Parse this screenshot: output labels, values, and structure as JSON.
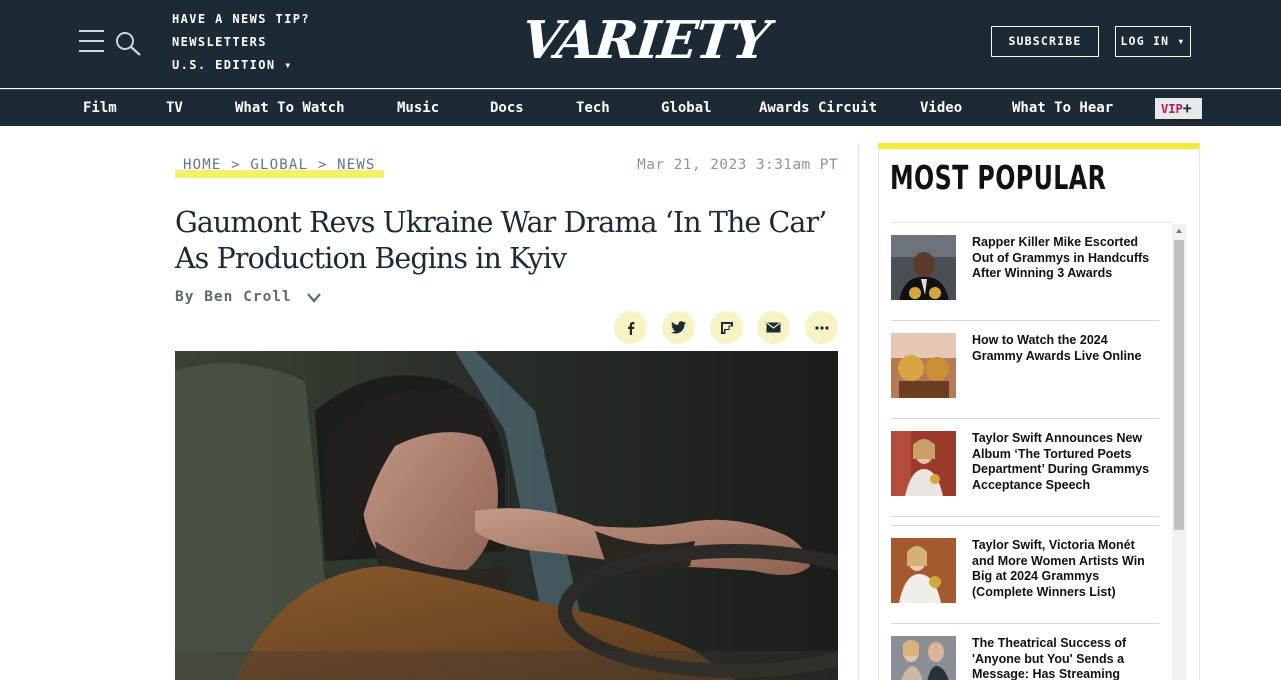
{
  "header": {
    "tips": [
      "HAVE A NEWS TIP?",
      "NEWSLETTERS",
      "U.S. EDITION ▾"
    ],
    "logo": "VARIETY",
    "subscribe_label": "SUBSCRIBE",
    "login_label": "LOG IN ▾"
  },
  "nav": {
    "items": [
      "Film",
      "TV",
      "What To Watch",
      "Music",
      "Docs",
      "Tech",
      "Global",
      "Awards Circuit",
      "Video",
      "What To Hear"
    ],
    "vip_label": "VIP",
    "vip_plus": "+"
  },
  "article": {
    "breadcrumb": [
      "HOME",
      "GLOBAL",
      "NEWS"
    ],
    "breadcrumb_sep": ">",
    "date": "Mar 21, 2023 3:31am PT",
    "headline": "Gaumont Revs Ukraine War Drama ‘In The Car’ As Production Begins in Kyiv",
    "byline": "By Ben Croll",
    "share_icons": [
      "facebook-icon",
      "twitter-icon",
      "flipboard-icon",
      "email-icon",
      "more-icon"
    ]
  },
  "sidebar": {
    "title": "MOST POPULAR",
    "items": [
      "Rapper Killer Mike Escorted Out of Grammys in Handcuffs After Winning 3 Awards",
      "How to Watch the 2024 Grammy Awards Live Online",
      "Taylor Swift Announces New Album ‘The Tortured Poets Department’ During Grammys Acceptance Speech",
      "Taylor Swift, Victoria Monét and More Women Artists Win Big at 2024 Grammys (Complete Winners List)",
      "The Theatrical Success of 'Anyone but You' Sends a Message: Has Streaming"
    ]
  },
  "colors": {
    "header_bg": "#1b2a35",
    "highlight_yellow": "#f4f06b",
    "accent_yellow": "#f4ea3a",
    "vip_red": "#c2185b"
  }
}
